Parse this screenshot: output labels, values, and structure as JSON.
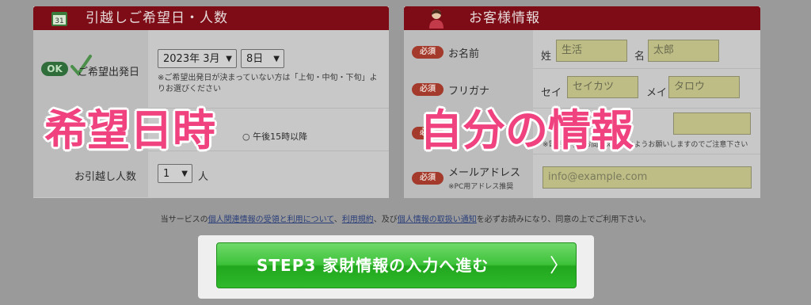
{
  "left_panel": {
    "title": "引越しご希望日・人数",
    "ok_badge": "OK",
    "date_label": "ご希望出発日",
    "month_select": "2023年 3月",
    "day_select": "8日",
    "date_note": "※ご希望出発日が決まっていない方は「上旬・中旬・下旬」よりお選びください",
    "time_option": "午後15時以降",
    "people_label": "お引越し人数",
    "people_select": "1",
    "people_unit": "人"
  },
  "right_panel": {
    "title": "お客様情報",
    "required": "必須",
    "name_label": "お名前",
    "sei_label": "姓",
    "sei_value": "生活",
    "mei_label": "名",
    "mei_value": "太郎",
    "kana_label": "フリガナ",
    "sei_kana_label": "セイ",
    "sei_kana_value": "セイカツ",
    "mei_kana_label": "メイ",
    "mei_kana_value": "タロウ",
    "phone_note": "※電話番号のお間違えの無いようお願いしますのでご注意下さい",
    "email_label": "メールアドレス",
    "email_sub": "※PC用アドレス推奨",
    "email_placeholder": "info@example.com"
  },
  "notice": {
    "prefix": "当サービスの",
    "link1": "個人関連情報の受領と利用について",
    "sep1": "、",
    "link2": "利用規約",
    "sep2": "、及び",
    "link3": "個人情報の取扱い通知",
    "suffix": "を必ずお読みになり、同意の上でご利用下さい。"
  },
  "button": {
    "label": "STEP3 家財情報の入力へ進む",
    "arrow": "〉"
  },
  "overlays": {
    "left": "希望日時",
    "right": "自分の情報"
  }
}
